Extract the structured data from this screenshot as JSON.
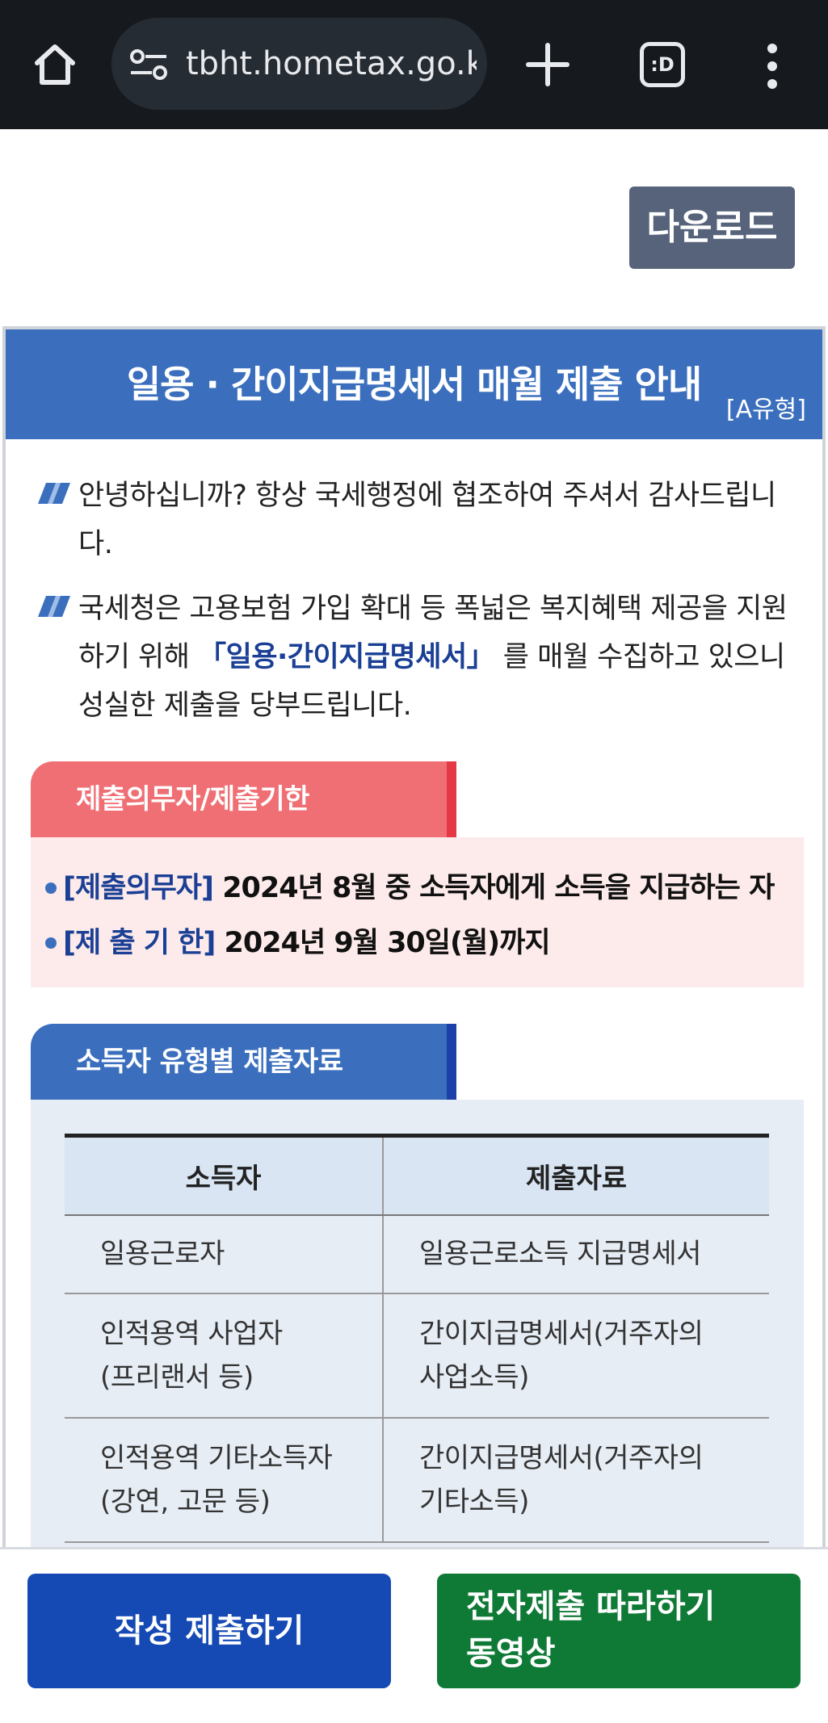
{
  "browser": {
    "url": "tbht.hometax.go.kr",
    "tab_label": ":D"
  },
  "download_label": "다운로드",
  "notice": {
    "title": "일용 · 간이지급명세서 매월 제출 안내",
    "tag": "[A유형]",
    "para1": "안녕하십니까? 항상 국세행정에 협조하여 주셔서 감사드립니다.",
    "para2_before": "국세청은 고용보험 가입 확대 등 폭넓은 복지혜택 제공을 지원하기 위해 ",
    "para2_highlight": "「일용·간이지급명세서」",
    "para2_after": " 를 매월 수집하고 있으니 성실한 제출을 당부드립니다."
  },
  "section1": {
    "title": "제출의무자/제출기한",
    "rows": [
      {
        "key": "[제출의무자]",
        "value": "2024년 8월 중 소득자에게 소득을 지급하는 자"
      },
      {
        "key": "[제 출 기 한]",
        "value": "2024년 9월 30일(월)까지"
      }
    ]
  },
  "section2": {
    "title": "소득자 유형별 제출자료",
    "headers": [
      "소득자",
      "제출자료"
    ],
    "rows": [
      [
        "일용근로자",
        "일용근로소득 지급명세서"
      ],
      [
        "인적용역 사업자\n(프리랜서 등)",
        "간이지급명세서(거주자의\n사업소득)"
      ],
      [
        "인적용역 기타소득자\n(강연, 고문 등)",
        "간이지급명세서(거주자의\n기타소득)"
      ]
    ]
  },
  "actions": {
    "write": "작성 제출하기",
    "video_line1": "전자제출 따라하기",
    "video_line2": "동영상"
  },
  "colors": {
    "header_blue": "#3b6fbe",
    "section1_red": "#ef6f74",
    "write_button": "#1549b4",
    "video_button": "#0f7a36",
    "download_button": "#56637a"
  }
}
